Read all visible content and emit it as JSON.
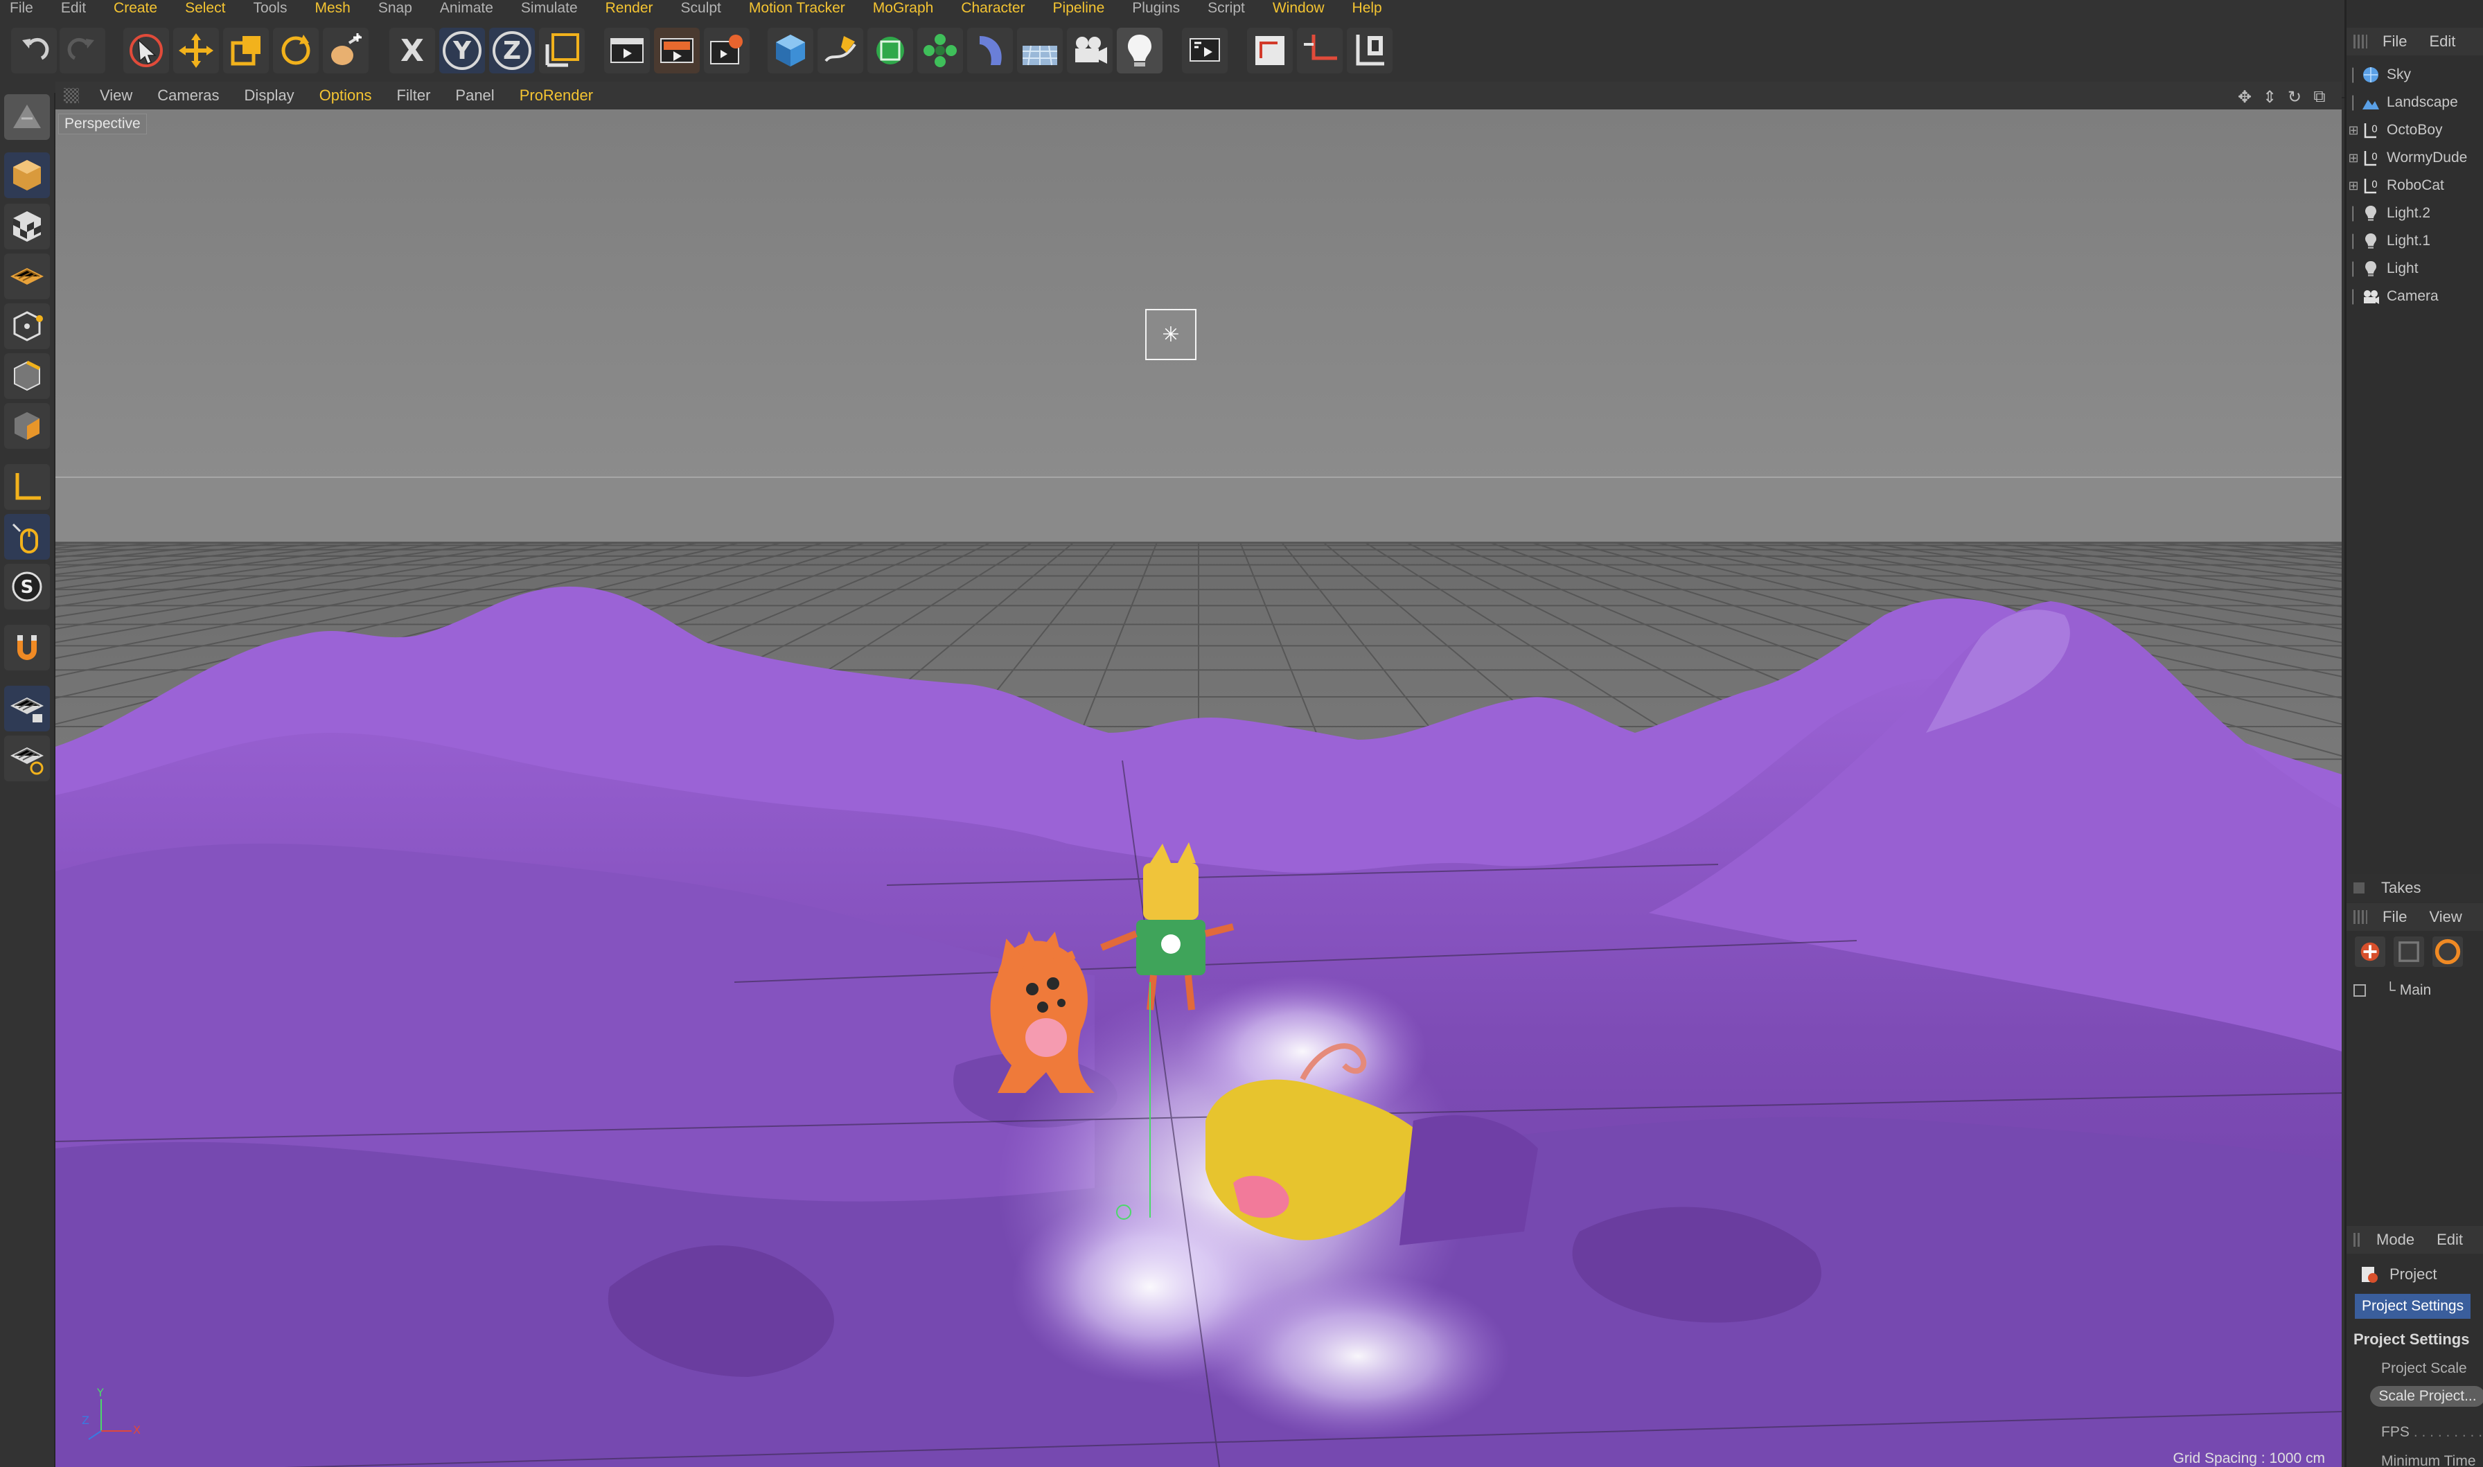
{
  "menubar": {
    "items": [
      {
        "label": "File",
        "hl": false
      },
      {
        "label": "Edit",
        "hl": false
      },
      {
        "label": "Create",
        "hl": true
      },
      {
        "label": "Select",
        "hl": true
      },
      {
        "label": "Tools",
        "hl": false
      },
      {
        "label": "Mesh",
        "hl": true
      },
      {
        "label": "Snap",
        "hl": false
      },
      {
        "label": "Animate",
        "hl": false
      },
      {
        "label": "Simulate",
        "hl": false
      },
      {
        "label": "Render",
        "hl": true
      },
      {
        "label": "Sculpt",
        "hl": false
      },
      {
        "label": "Motion Tracker",
        "hl": true
      },
      {
        "label": "MoGraph",
        "hl": true
      },
      {
        "label": "Character",
        "hl": true
      },
      {
        "label": "Pipeline",
        "hl": true
      },
      {
        "label": "Plugins",
        "hl": false
      },
      {
        "label": "Script",
        "hl": false
      },
      {
        "label": "Window",
        "hl": true
      },
      {
        "label": "Help",
        "hl": true
      }
    ]
  },
  "toolbar": {
    "axis_x": "X",
    "axis_y": "Y",
    "axis_z": "Z",
    "icons": [
      "undo-icon",
      "redo-icon",
      "live-selection-icon",
      "move-icon",
      "scale-icon",
      "rotate-icon",
      "recent-tools-icon",
      "x-axis-icon",
      "y-axis-icon",
      "z-axis-icon",
      "coordinate-system-icon",
      "render-view-icon",
      "render-to-picture-viewer-icon",
      "render-settings-icon",
      "cube-icon",
      "pen-icon",
      "subdivision-icon",
      "cloner-icon",
      "deformer-icon",
      "floor-icon",
      "camera-icon",
      "light-icon",
      "ipr-icon",
      "workplane-icon",
      "snap-icon",
      "lock-axis-icon"
    ]
  },
  "viewport": {
    "menu": [
      {
        "label": "View",
        "hl": false
      },
      {
        "label": "Cameras",
        "hl": false
      },
      {
        "label": "Display",
        "hl": false
      },
      {
        "label": "Options",
        "hl": true
      },
      {
        "label": "Filter",
        "hl": false
      },
      {
        "label": "Panel",
        "hl": false
      },
      {
        "label": "ProRender",
        "hl": true
      }
    ],
    "label": "Perspective",
    "grid_spacing": "Grid Spacing : 1000 cm",
    "colors": {
      "sky": "#8c8c8c",
      "floor": "#7d7d7d",
      "landscape": "#8a55c4",
      "highlight": "#efe6ff"
    }
  },
  "object_manager": {
    "menu": [
      "File",
      "Edit"
    ],
    "objects": [
      {
        "name": "Sky",
        "icon": "sky-icon",
        "expandable": false
      },
      {
        "name": "Landscape",
        "icon": "landscape-icon",
        "expandable": false
      },
      {
        "name": "OctoBoy",
        "icon": "null-object-icon",
        "expandable": true
      },
      {
        "name": "WormyDude",
        "icon": "null-object-icon",
        "expandable": true
      },
      {
        "name": "RoboCat",
        "icon": "null-object-icon",
        "expandable": true
      },
      {
        "name": "Light.2",
        "icon": "light-icon",
        "expandable": false
      },
      {
        "name": "Light.1",
        "icon": "light-icon",
        "expandable": false
      },
      {
        "name": "Light",
        "icon": "light-icon",
        "expandable": false
      },
      {
        "name": "Camera",
        "icon": "camera-icon",
        "expandable": false
      }
    ]
  },
  "takes": {
    "title": "Takes",
    "menu": [
      "File",
      "View"
    ],
    "main_take": "Main"
  },
  "attributes": {
    "menu": [
      "Mode",
      "Edit"
    ],
    "object": "Project",
    "tab": "Project Settings",
    "section": "Project Settings",
    "field_scale": "Project Scale",
    "button_scale": "Scale Project...",
    "field_fps": "FPS",
    "field_min_time": "Minimum Time"
  }
}
